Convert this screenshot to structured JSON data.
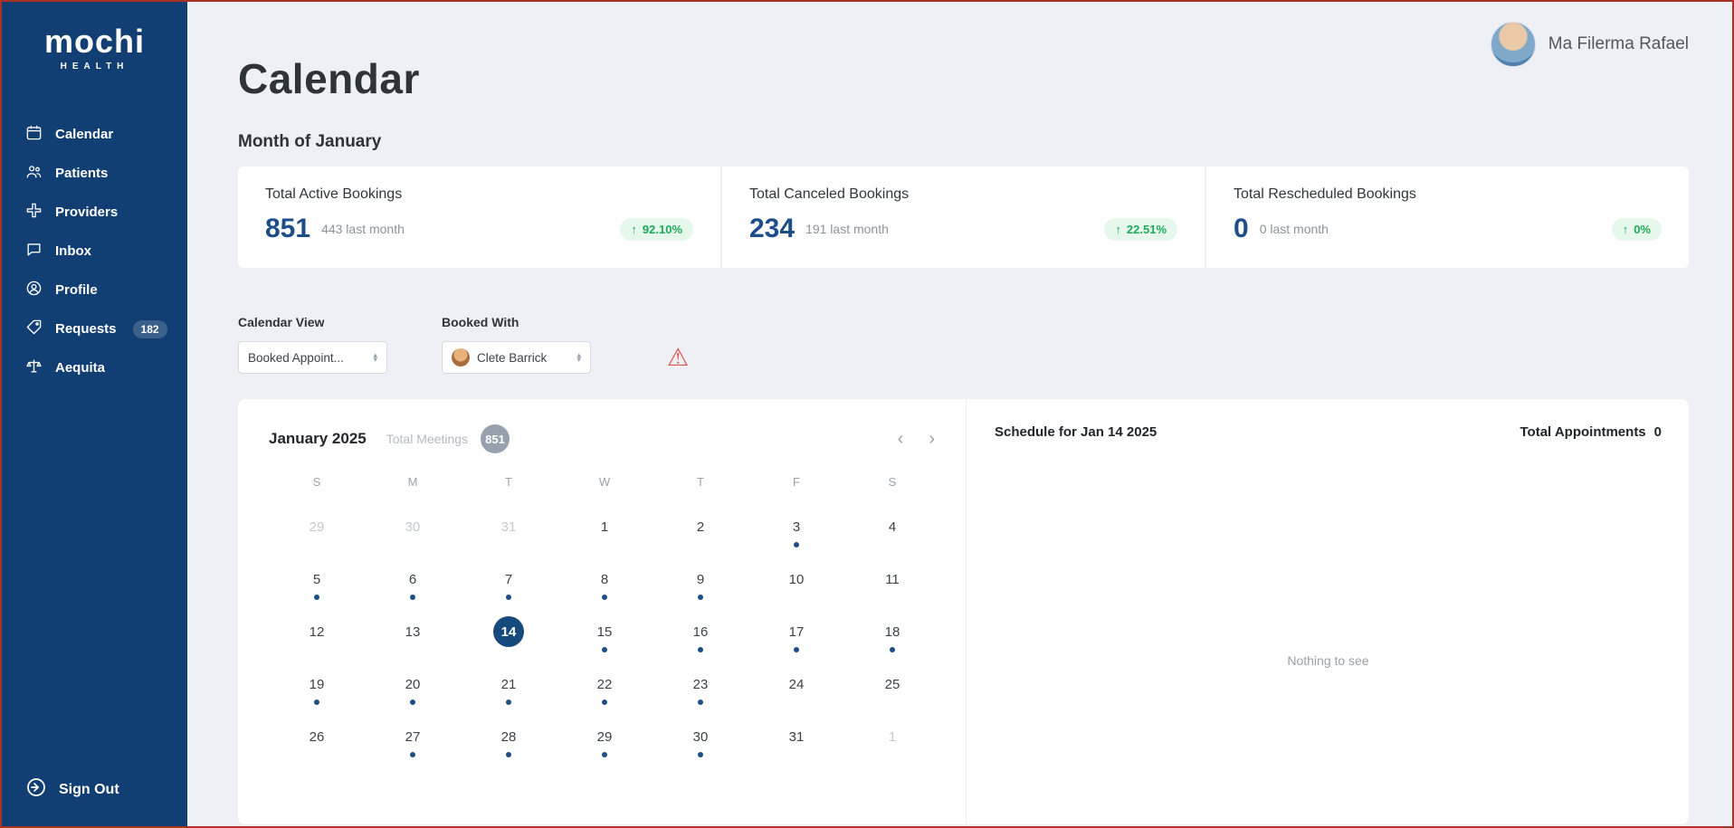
{
  "sidebar": {
    "logo": {
      "title": "mochi",
      "subtitle": "HEALTH"
    },
    "items": [
      {
        "label": "Calendar",
        "icon": "calendar-icon"
      },
      {
        "label": "Patients",
        "icon": "patients-icon"
      },
      {
        "label": "Providers",
        "icon": "providers-icon"
      },
      {
        "label": "Inbox",
        "icon": "inbox-icon"
      },
      {
        "label": "Profile",
        "icon": "profile-icon"
      },
      {
        "label": "Requests",
        "icon": "requests-icon",
        "badge": "182"
      },
      {
        "label": "Aequita",
        "icon": "aequita-icon"
      }
    ],
    "sign_out": "Sign Out"
  },
  "header": {
    "user_name": "Ma Filerma Rafael"
  },
  "page": {
    "title": "Calendar",
    "subtitle": "Month of January"
  },
  "stats": [
    {
      "label": "Total Active Bookings",
      "value": "851",
      "last_month": "443 last month",
      "delta": "92.10%"
    },
    {
      "label": "Total Canceled Bookings",
      "value": "234",
      "last_month": "191 last month",
      "delta": "22.51%"
    },
    {
      "label": "Total Rescheduled Bookings",
      "value": "0",
      "last_month": "0 last month",
      "delta": "0%"
    }
  ],
  "filters": {
    "calendar_view_label": "Calendar View",
    "calendar_view_value": "Booked Appoint...",
    "booked_with_label": "Booked With",
    "booked_with_value": "Clete Barrick"
  },
  "calendar": {
    "month_title": "January 2025",
    "total_meetings_label": "Total Meetings",
    "total_meetings_value": "851",
    "nav_prev": "‹",
    "nav_next": "›",
    "day_headers": [
      "S",
      "M",
      "T",
      "W",
      "T",
      "F",
      "S"
    ],
    "weeks": [
      [
        {
          "d": "29",
          "muted": true
        },
        {
          "d": "30",
          "muted": true
        },
        {
          "d": "31",
          "muted": true
        },
        {
          "d": "1"
        },
        {
          "d": "2"
        },
        {
          "d": "3",
          "dot": true
        },
        {
          "d": "4"
        }
      ],
      [
        {
          "d": "5",
          "dot": true
        },
        {
          "d": "6",
          "dot": true
        },
        {
          "d": "7",
          "dot": true
        },
        {
          "d": "8",
          "dot": true
        },
        {
          "d": "9",
          "dot": true
        },
        {
          "d": "10"
        },
        {
          "d": "11"
        }
      ],
      [
        {
          "d": "12"
        },
        {
          "d": "13"
        },
        {
          "d": "14",
          "selected": true
        },
        {
          "d": "15",
          "dot": true
        },
        {
          "d": "16",
          "dot": true
        },
        {
          "d": "17",
          "dot": true
        },
        {
          "d": "18",
          "dot": true
        }
      ],
      [
        {
          "d": "19",
          "dot": true
        },
        {
          "d": "20",
          "dot": true
        },
        {
          "d": "21",
          "dot": true
        },
        {
          "d": "22",
          "dot": true
        },
        {
          "d": "23",
          "dot": true
        },
        {
          "d": "24"
        },
        {
          "d": "25"
        }
      ],
      [
        {
          "d": "26"
        },
        {
          "d": "27",
          "dot": true
        },
        {
          "d": "28",
          "dot": true
        },
        {
          "d": "29",
          "dot": true
        },
        {
          "d": "30",
          "dot": true
        },
        {
          "d": "31"
        },
        {
          "d": "1",
          "muted": true
        }
      ]
    ]
  },
  "schedule": {
    "title": "Schedule for Jan 14 2025",
    "total_appointments_label": "Total Appointments",
    "total_appointments_value": "0",
    "empty_text": "Nothing to see"
  },
  "colors": {
    "sidebar": "#113e73",
    "accent_blue": "#1d4e89",
    "green": "#1faa59",
    "green_bg": "#e6f7ec",
    "warning_red": "#e05347",
    "border_red": "#a93226"
  }
}
